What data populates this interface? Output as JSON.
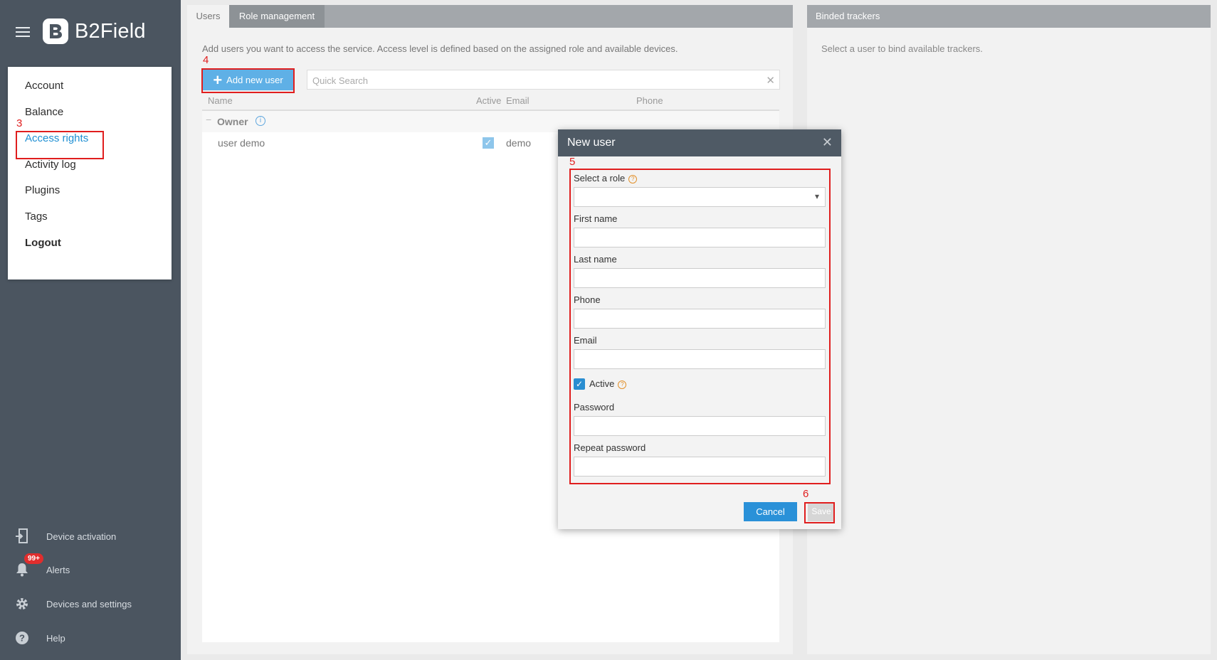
{
  "app": {
    "name": "B2Field"
  },
  "menu": {
    "items": [
      "Account",
      "Balance",
      "Access rights",
      "Activity log",
      "Plugins",
      "Tags",
      "Logout"
    ]
  },
  "sidebar_bottom": {
    "device_activation": "Device activation",
    "alerts": "Alerts",
    "alerts_badge": "99+",
    "devices_settings": "Devices and settings",
    "help": "Help"
  },
  "annotations": {
    "a3": "3",
    "a4": "4",
    "a5": "5",
    "a6": "6"
  },
  "tabs": [
    "Users",
    "Role management"
  ],
  "users": {
    "description": "Add users you want to access the service. Access level is defined based on the assigned role and available devices.",
    "add_button": "Add new user",
    "search_placeholder": "Quick Search",
    "columns": [
      "Name",
      "Active",
      "Email",
      "Phone"
    ],
    "group": "Owner",
    "rows": [
      {
        "name": "user demo",
        "active": true,
        "email": "demo"
      }
    ]
  },
  "binded": {
    "title": "Binded trackers",
    "text": "Select a user to bind available trackers."
  },
  "modal": {
    "title": "New user",
    "role_label": "Select a role",
    "first_name_label": "First name",
    "last_name_label": "Last name",
    "phone_label": "Phone",
    "email_label": "Email",
    "active_label": "Active",
    "active_checked": true,
    "password_label": "Password",
    "repeat_password_label": "Repeat password",
    "cancel": "Cancel",
    "save": "Save"
  },
  "colors": {
    "sidebar": "#4b5560",
    "accent": "#2a91d8",
    "annotation": "#e01e1e"
  }
}
